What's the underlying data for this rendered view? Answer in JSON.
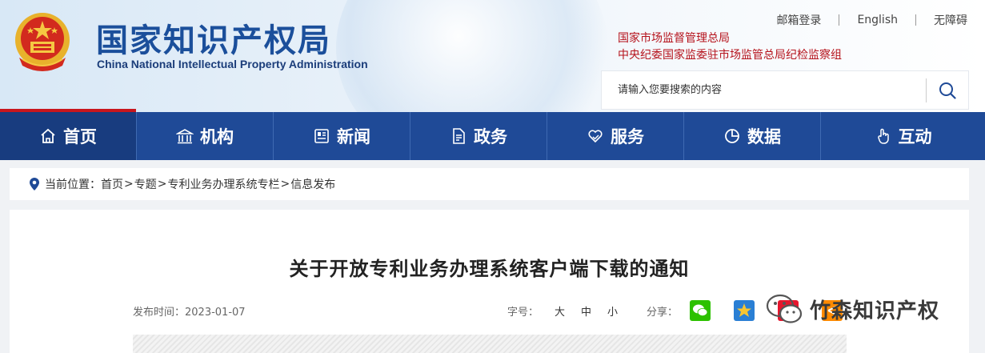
{
  "header": {
    "logo_cn": "国家知识产权局",
    "logo_en": "China National Intellectual Property Administration",
    "top_links": [
      "邮箱登录",
      "English",
      "无障碍"
    ],
    "agencies": [
      "国家市场监督管理总局",
      "中央纪委国家监委驻市场监管总局纪检监察组"
    ],
    "search_placeholder": "请输入您要搜索的内容",
    "search_icon": "search-icon"
  },
  "nav": {
    "items": [
      {
        "label": "首页",
        "icon": "home-icon",
        "active": true
      },
      {
        "label": "机构",
        "icon": "building-icon"
      },
      {
        "label": "新闻",
        "icon": "newspaper-icon"
      },
      {
        "label": "政务",
        "icon": "document-icon"
      },
      {
        "label": "服务",
        "icon": "heart-hand-icon"
      },
      {
        "label": "数据",
        "icon": "pie-chart-icon"
      },
      {
        "label": "互动",
        "icon": "pointer-icon"
      }
    ]
  },
  "breadcrumb": {
    "prefix": "当前位置：",
    "items": [
      "首页",
      "专题",
      "专利业务办理系统专栏",
      "信息发布"
    ],
    "separator": ">"
  },
  "article": {
    "title": "关于开放专利业务办理系统客户端下载的通知",
    "publish_label": "发布时间：2023-01-07",
    "font_label": "字号：",
    "font_sizes": [
      "大",
      "中",
      "小"
    ],
    "share_label": "分享："
  },
  "share": [
    "wechat-icon",
    "qzone-icon",
    "weibo-icon",
    "share-icon"
  ],
  "watermark": {
    "text": "竹森知识产权",
    "icon": "wechat-icon"
  },
  "colors": {
    "nav_bg": "#1f4a97",
    "nav_active": "#183c7f",
    "accent_red": "#c8161d",
    "logo_blue": "#1b4f9b",
    "agency_red": "#b5121b"
  }
}
